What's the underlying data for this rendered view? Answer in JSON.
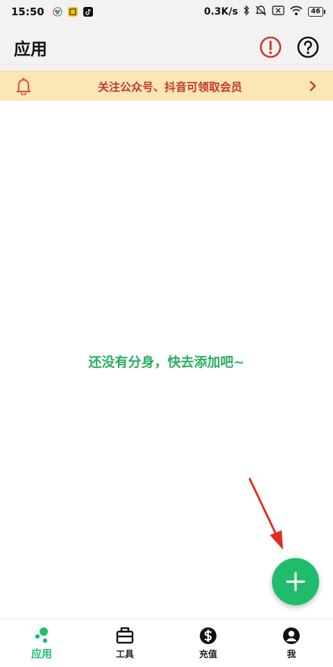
{
  "status_bar": {
    "time": "15:50",
    "net_speed": "0.3K/s",
    "battery": "46",
    "icons": [
      "app-notification-icon",
      "app-notification-icon",
      "tiktok-icon",
      "bluetooth-icon",
      "mute-icon",
      "sim-icon",
      "wifi-icon",
      "battery-icon"
    ]
  },
  "header": {
    "title": "应用",
    "icons": [
      "alert-icon",
      "help-icon"
    ]
  },
  "banner": {
    "icon": "bell-icon",
    "text": "关注公众号、抖音可领取会员",
    "chevron": "chevron-right-icon"
  },
  "main": {
    "empty_text": "还没有分身，快去添加吧~"
  },
  "fab": {
    "icon": "plus-icon"
  },
  "tabs": [
    {
      "label": "应用",
      "icon": "apps-icon",
      "active": true
    },
    {
      "label": "工具",
      "icon": "tools-icon",
      "active": false
    },
    {
      "label": "充值",
      "icon": "dollar-icon",
      "active": false
    },
    {
      "label": "我",
      "icon": "user-icon",
      "active": false
    }
  ],
  "colors": {
    "accent": "#1fbd6b",
    "banner_bg": "#fde6b6",
    "banner_text": "#c0392b",
    "alert": "#d0312d",
    "empty_text": "#27ae60",
    "annotation_arrow": "#e32b1e"
  }
}
